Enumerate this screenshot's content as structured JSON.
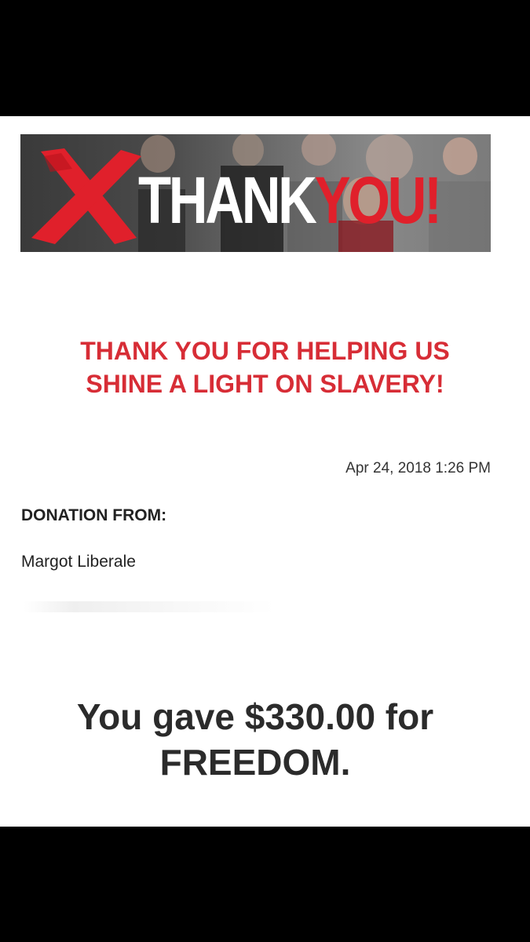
{
  "banner": {
    "word_white": "THANK",
    "word_red": "YOU!",
    "x_icon": "red-x-mark",
    "colors": {
      "red": "#e0202b",
      "white": "#ffffff"
    }
  },
  "headline": {
    "line1": "THANK YOU FOR HELPING US",
    "line2": "SHINE A LIGHT ON SLAVERY!",
    "color": "#d72d36"
  },
  "timestamp": "Apr 24, 2018 1:26 PM",
  "donation": {
    "from_label": "DONATION FROM:",
    "donor_name": "Margot Liberale"
  },
  "gift": {
    "line1": "You gave $330.00 for",
    "line2": "FREEDOM."
  }
}
